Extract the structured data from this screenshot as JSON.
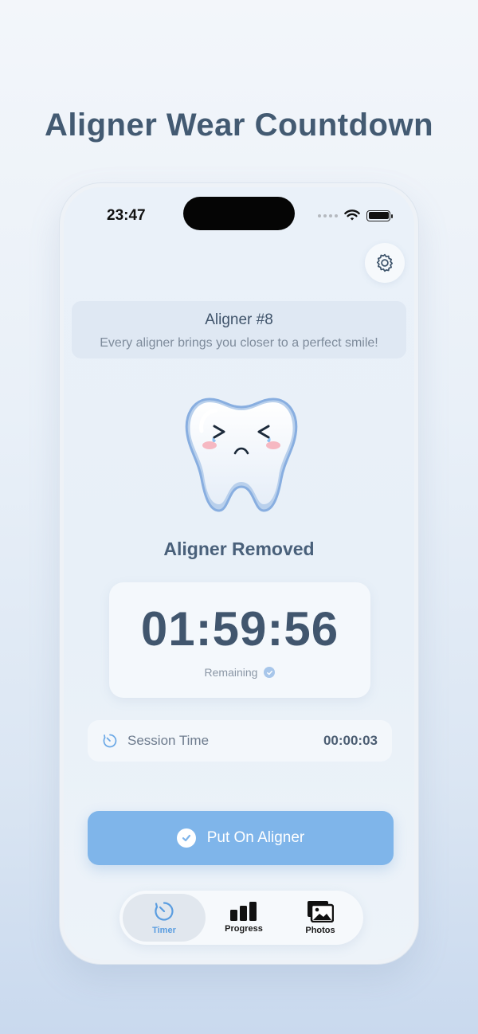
{
  "page": {
    "heading": "Aligner Wear Countdown"
  },
  "status_bar": {
    "time": "23:47"
  },
  "aligner": {
    "title": "Aligner #8",
    "subtitle": "Every aligner brings you closer to a perfect smile!"
  },
  "state": {
    "label": "Aligner Removed"
  },
  "timer": {
    "remaining": "01:59:56",
    "remaining_label": "Remaining"
  },
  "session": {
    "label": "Session Time",
    "value": "00:00:03"
  },
  "primary_action": {
    "label": "Put On Aligner"
  },
  "tabs": [
    {
      "label": "Timer",
      "icon": "timer-icon",
      "active": true
    },
    {
      "label": "Progress",
      "icon": "bar-chart-icon",
      "active": false
    },
    {
      "label": "Photos",
      "icon": "photos-icon",
      "active": false
    }
  ],
  "colors": {
    "accent": "#7fb5ea",
    "active_tab": "#5a9de0",
    "text_dark": "#41566e"
  }
}
